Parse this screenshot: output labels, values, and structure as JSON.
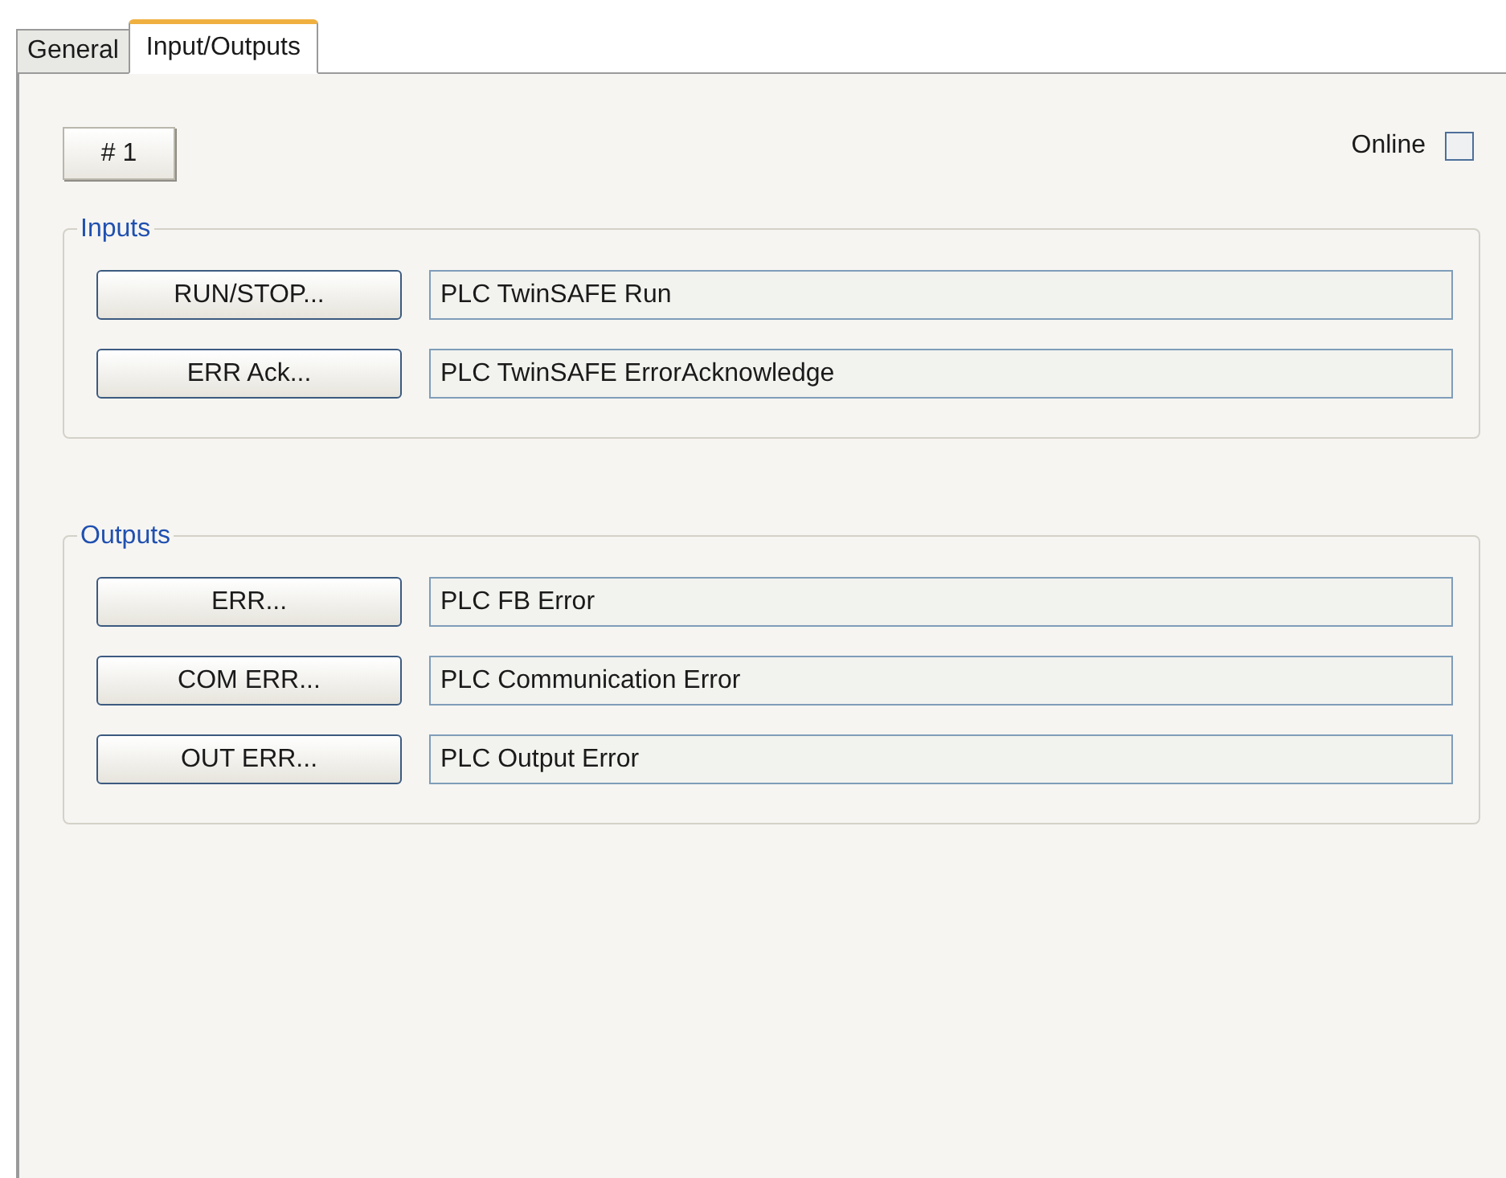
{
  "tabs": [
    {
      "label": "General",
      "selected": false
    },
    {
      "label": "Input/Outputs",
      "selected": true
    }
  ],
  "instance_button": "# 1",
  "online": {
    "label": "Online",
    "checked": false
  },
  "groups": [
    {
      "title": "Inputs",
      "rows": [
        {
          "button": "RUN/STOP...",
          "value": "PLC TwinSAFE Run"
        },
        {
          "button": "ERR Ack...",
          "value": "PLC TwinSAFE ErrorAcknowledge"
        }
      ]
    },
    {
      "title": "Outputs",
      "rows": [
        {
          "button": "ERR...",
          "value": "PLC FB Error"
        },
        {
          "button": "COM ERR...",
          "value": "PLC Communication Error"
        },
        {
          "button": "OUT ERR...",
          "value": "PLC Output Error"
        }
      ]
    }
  ]
}
